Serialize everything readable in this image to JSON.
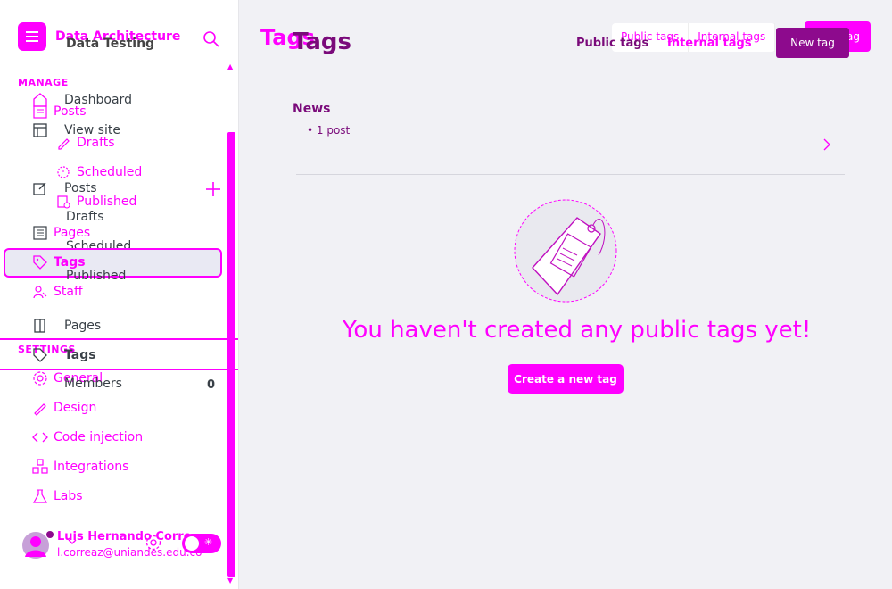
{
  "sidebar": {
    "brand": {
      "title": "Data Architecture",
      "subtitle": "Data Testing"
    },
    "manage_label": "MANAGE",
    "settings_label": "SETTINGS",
    "nav_dark": {
      "dashboard": "Dashboard",
      "view_site": "View site",
      "posts": "Posts",
      "drafts": "Drafts",
      "scheduled": "Scheduled",
      "published": "Published",
      "pages": "Pages",
      "tags": "Tags",
      "members": "Members",
      "members_count": "0"
    },
    "nav_pink": {
      "posts": "Posts",
      "drafts": "Drafts",
      "scheduled": "Scheduled",
      "published": "Published",
      "pages": "Pages",
      "tags": "Tags",
      "staff": "Staff",
      "general": "General",
      "design": "Design",
      "code_injection": "Code injection",
      "integrations": "Integrations",
      "labs": "Labs"
    },
    "user": {
      "name": "Luis Hernando Corre",
      "email": "l.correaz@uniandes.edu.co"
    }
  },
  "main": {
    "title": "Tags",
    "title_ghost": "Tags",
    "tabs_ghost": [
      "Public tags",
      "Internal tags"
    ],
    "new_tag_ghost": "New tag",
    "tab_public": "Public tags",
    "tab_internal": "Internal tags",
    "new_tag_button": "New tag",
    "tag": {
      "name": "News",
      "count": "• 1 post"
    },
    "empty_message": "You haven't created any public tags yet!",
    "create_button": "Create a new tag"
  },
  "colors": {
    "accent": "#ff00ff",
    "dark_accent": "#7a0a7a",
    "button_dark": "#8d0a8d"
  }
}
